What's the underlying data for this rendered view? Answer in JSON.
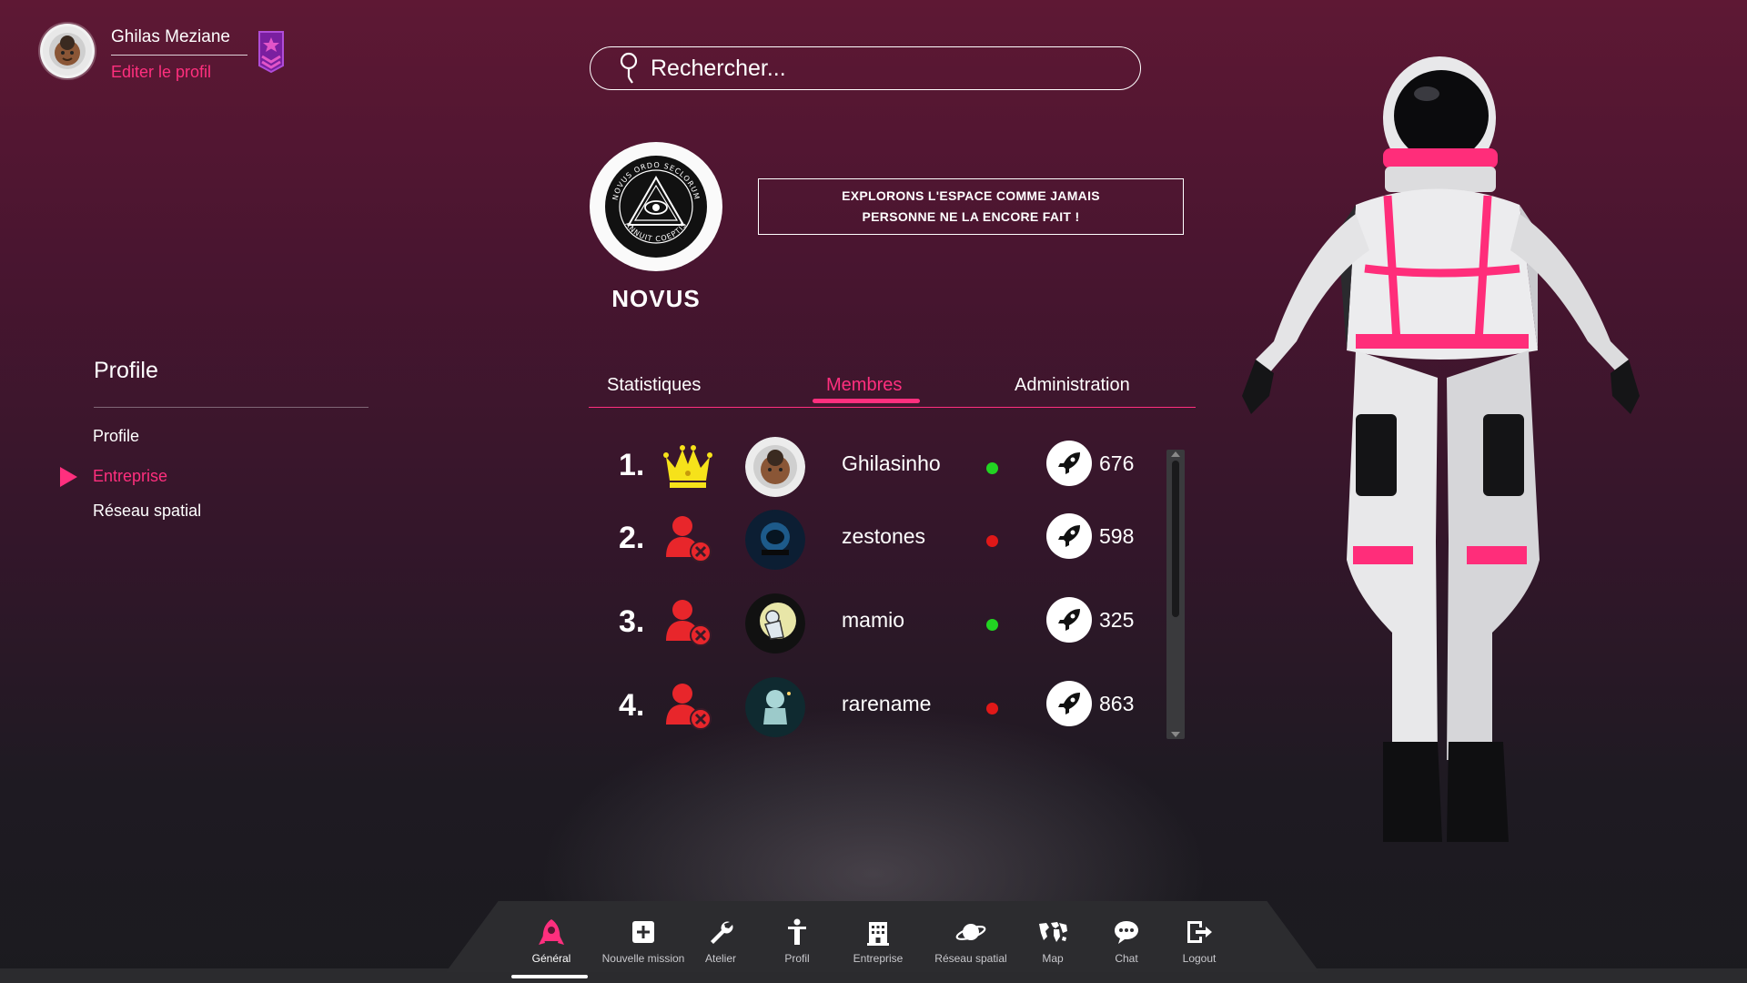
{
  "user": {
    "name": "Ghilas Meziane",
    "edit_label": "Editer le profil",
    "avatar_icon": "astronaut-avatar-icon",
    "rank_badge_icon": "rank-badge-icon"
  },
  "sidebar": {
    "title": "Profile",
    "items": [
      {
        "label": "Profile",
        "active": false
      },
      {
        "label": "Entreprise",
        "active": true
      },
      {
        "label": "Réseau spatial",
        "active": false
      }
    ]
  },
  "search": {
    "placeholder": "Rechercher..."
  },
  "company": {
    "name": "NOVUS",
    "motto_line1": "EXPLORONS L'ESPACE COMME JAMAIS",
    "motto_line2": "PERSONNE NE LA ENCORE FAIT !",
    "logo_text_top": "NOVUS ORDO SECLORUM",
    "logo_text_bottom": "ANNUIT COEPTIS"
  },
  "tabs": [
    {
      "label": "Statistiques",
      "active": false
    },
    {
      "label": "Membres",
      "active": true
    },
    {
      "label": "Administration",
      "active": false
    }
  ],
  "members": [
    {
      "rank": "1.",
      "role": "crown-icon",
      "name": "Ghilasinho",
      "online": true,
      "score": "676"
    },
    {
      "rank": "2.",
      "role": "remove-user-icon",
      "name": "zestones",
      "online": false,
      "score": "598"
    },
    {
      "rank": "3.",
      "role": "remove-user-icon",
      "name": "mamio",
      "online": true,
      "score": "325"
    },
    {
      "rank": "4.",
      "role": "remove-user-icon",
      "name": "rarename",
      "online": false,
      "score": "863"
    }
  ],
  "colors": {
    "accent": "#ff2f7e",
    "online": "#22d322",
    "offline": "#e01818"
  },
  "dock": [
    {
      "label": "Général",
      "icon": "rocket-icon",
      "active": true
    },
    {
      "label": "Nouvelle mission",
      "icon": "plus-square-icon",
      "active": false
    },
    {
      "label": "Atelier",
      "icon": "wrench-icon",
      "active": false
    },
    {
      "label": "Profil",
      "icon": "person-icon",
      "active": false
    },
    {
      "label": "Entreprise",
      "icon": "building-icon",
      "active": false
    },
    {
      "label": "Réseau spatial",
      "icon": "planet-icon",
      "active": false
    },
    {
      "label": "Map",
      "icon": "world-map-icon",
      "active": false
    },
    {
      "label": "Chat",
      "icon": "chat-bubble-icon",
      "active": false
    },
    {
      "label": "Logout",
      "icon": "logout-icon",
      "active": false
    }
  ]
}
